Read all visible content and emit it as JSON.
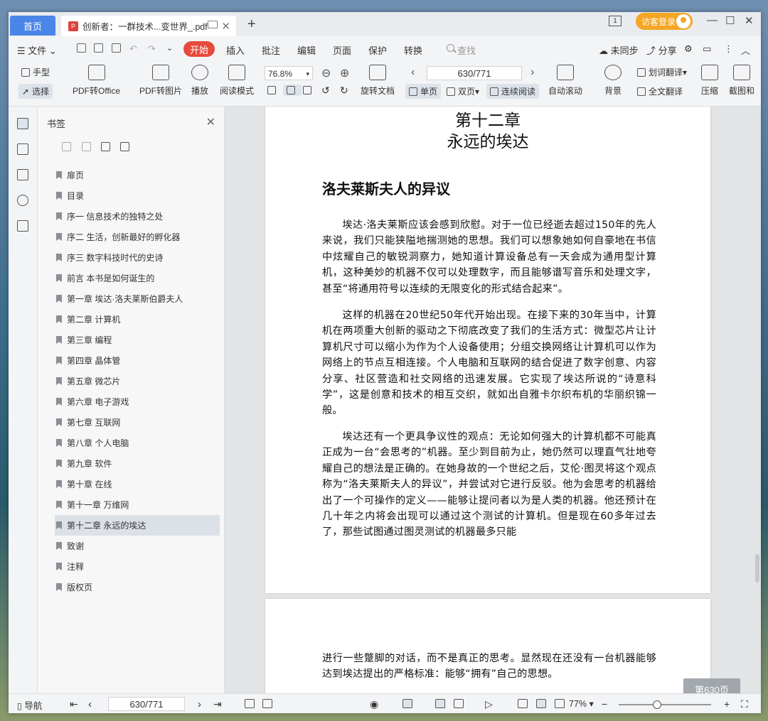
{
  "titlebar": {
    "home_tab": "首页",
    "doc_tab": "创新者：一群技术...变世界_.pdf",
    "login": "访客登录",
    "badge": "1"
  },
  "menubar": {
    "file": "文件",
    "start": "开始",
    "items": [
      "插入",
      "批注",
      "编辑",
      "页面",
      "保护",
      "转换"
    ],
    "search": "查找",
    "sync": "未同步",
    "share": "分享"
  },
  "ribbon": {
    "hand": "手型",
    "select": "选择",
    "pdf_office": "PDF转Office",
    "pdf_image": "PDF转图片",
    "play": "播放",
    "read_mode": "阅读模式",
    "zoom": "76.8%",
    "rotate": "旋转文档",
    "page": "630/771",
    "single": "单页",
    "double": "双页",
    "continuous": "连续阅读",
    "auto_scroll": "自动滚动",
    "background": "背景",
    "word_translate": "划词翻译",
    "full_translate": "全文翻译",
    "compress": "压缩",
    "screenshot": "截图和"
  },
  "bookmarks": {
    "title": "书签",
    "items": [
      "扉页",
      "目录",
      "序一 信息技术的独特之处",
      "序二 生活，创新最好的孵化器",
      "序三 数字科技时代的史诗",
      "前言 本书是如何诞生的",
      "第一章 埃达·洛夫莱斯伯爵夫人",
      "第二章 计算机",
      "第三章 编程",
      "第四章 晶体管",
      "第五章 微芯片",
      "第六章 电子游戏",
      "第七章 互联网",
      "第八章 个人电脑",
      "第九章 软件",
      "第十章 在线",
      "第十一章 万维网",
      "第十二章 永远的埃达",
      "致谢",
      "注释",
      "版权页"
    ]
  },
  "document": {
    "chapter": "第十二章",
    "chapter_title": "永远的埃达",
    "section": "洛夫莱斯夫人的异议",
    "p1": "埃达·洛夫莱斯应该会感到欣慰。对于一位已经逝去超过150年的先人来说，我们只能狭隘地揣测她的思想。我们可以想象她如何自豪地在书信中炫耀自己的敏锐洞察力，她知道计算设备总有一天会成为通用型计算机，这种美妙的机器不仅可以处理数字，而且能够谱写音乐和处理文字，甚至“将通用符号以连续的无限变化的形式结合起来”。",
    "p2": "这样的机器在20世纪50年代开始出现。在接下来的30年当中，计算机在两项重大创新的驱动之下彻底改变了我们的生活方式：微型芯片让计算机尺寸可以缩小为作为个人设备使用；分组交换网络让计算机可以作为网络上的节点互相连接。个人电脑和互联网的结合促进了数字创意、内容分享、社区营造和社交网络的迅速发展。它实现了埃达所说的“诗意科学”，这是创意和技术的相互交织，就如出自雅卡尔织布机的华丽织锦一般。",
    "p3": "埃达还有一个更具争议性的观点：无论如何强大的计算机都不可能真正成为一台“会思考的”机器。至少到目前为止，她仍然可以理直气壮地夸耀自己的想法是正确的。在她身故的一个世纪之后，艾伦·图灵将这个观点称为“洛夫莱斯夫人的异议”，并尝试对它进行反驳。他为会思考的机器给出了一个可操作的定义——能够让提问者以为是人类的机器。他还预计在几十年之内将会出现可以通过这个测试的计算机。但是现在60多年过去了，那些试图通过图灵测试的机器最多只能",
    "p4": "进行一些蹩脚的对话，而不是真正的思考。显然现在还没有一台机器能够达到埃达提出的严格标准：能够“拥有”自己的思想。",
    "page_badge": "第630页"
  },
  "statusbar": {
    "nav": "导航",
    "page": "630/771",
    "zoom": "77%"
  }
}
